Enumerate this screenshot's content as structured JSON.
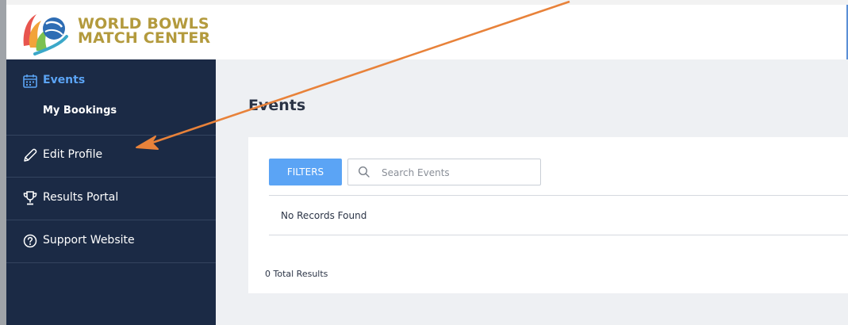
{
  "brand": {
    "line1": "WORLD BOWLS",
    "line2": "MATCH CENTER",
    "text_color": "#b39a3d"
  },
  "sidebar": {
    "background": "#1b2a45",
    "events": {
      "label": "Events",
      "icon": "calendar-icon",
      "active_color": "#5ba4f5"
    },
    "sub_items": [
      {
        "label": "My Bookings"
      }
    ],
    "items": [
      {
        "label": "Edit Profile",
        "icon": "pencil-icon"
      },
      {
        "label": "Results Portal",
        "icon": "trophy-icon"
      },
      {
        "label": "Support Website",
        "icon": "question-circle-icon"
      }
    ]
  },
  "main": {
    "title": "Events",
    "filters_label": "FILTERS",
    "search": {
      "placeholder": "Search Events",
      "value": ""
    },
    "empty_message": "No Records Found",
    "total_results": "0 Total Results"
  },
  "annotation": {
    "type": "arrow",
    "color": "#e8823a",
    "points_to": "Edit Profile"
  }
}
